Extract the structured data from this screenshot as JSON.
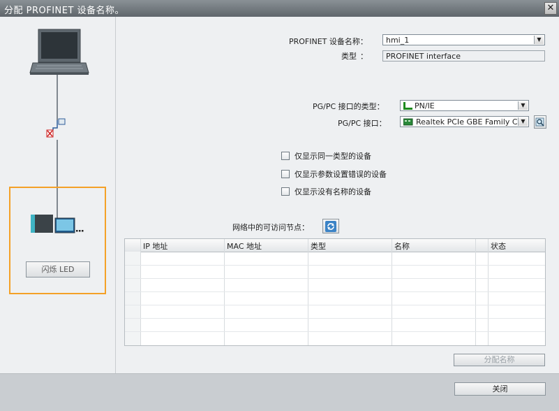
{
  "title": "分配 PROFINET 设备名称。",
  "close_x": "✕",
  "fields": {
    "device_name_label": "PROFINET 设备名称：",
    "device_name_value": "hmi_1",
    "type_label": "类型",
    "type_colon": "：",
    "type_value": "PROFINET interface",
    "pgpc_type_label": "PG/PC 接口的类型：",
    "pgpc_type_value": "PN/IE",
    "pgpc_if_label": "PG/PC 接口：",
    "pgpc_if_value": "Realtek PCIe GBE Family C..."
  },
  "filters": [
    "仅显示同一类型的设备",
    "仅显示参数设置错误的设备",
    "仅显示没有名称的设备"
  ],
  "nodes_label": "网络中的可访问节点：",
  "table": {
    "columns": [
      "IP 地址",
      "MAC 地址",
      "类型",
      "名称",
      "状态"
    ],
    "rows": []
  },
  "buttons": {
    "flash_led": "闪烁 LED",
    "assign_name": "分配名称",
    "close": "关闭"
  },
  "colors": {
    "highlight_border": "#f4a127"
  },
  "icons": {
    "refresh": "refresh-icon",
    "search": "search-icon",
    "pc": "pc-icon",
    "device": "plc-hmi-icon"
  }
}
